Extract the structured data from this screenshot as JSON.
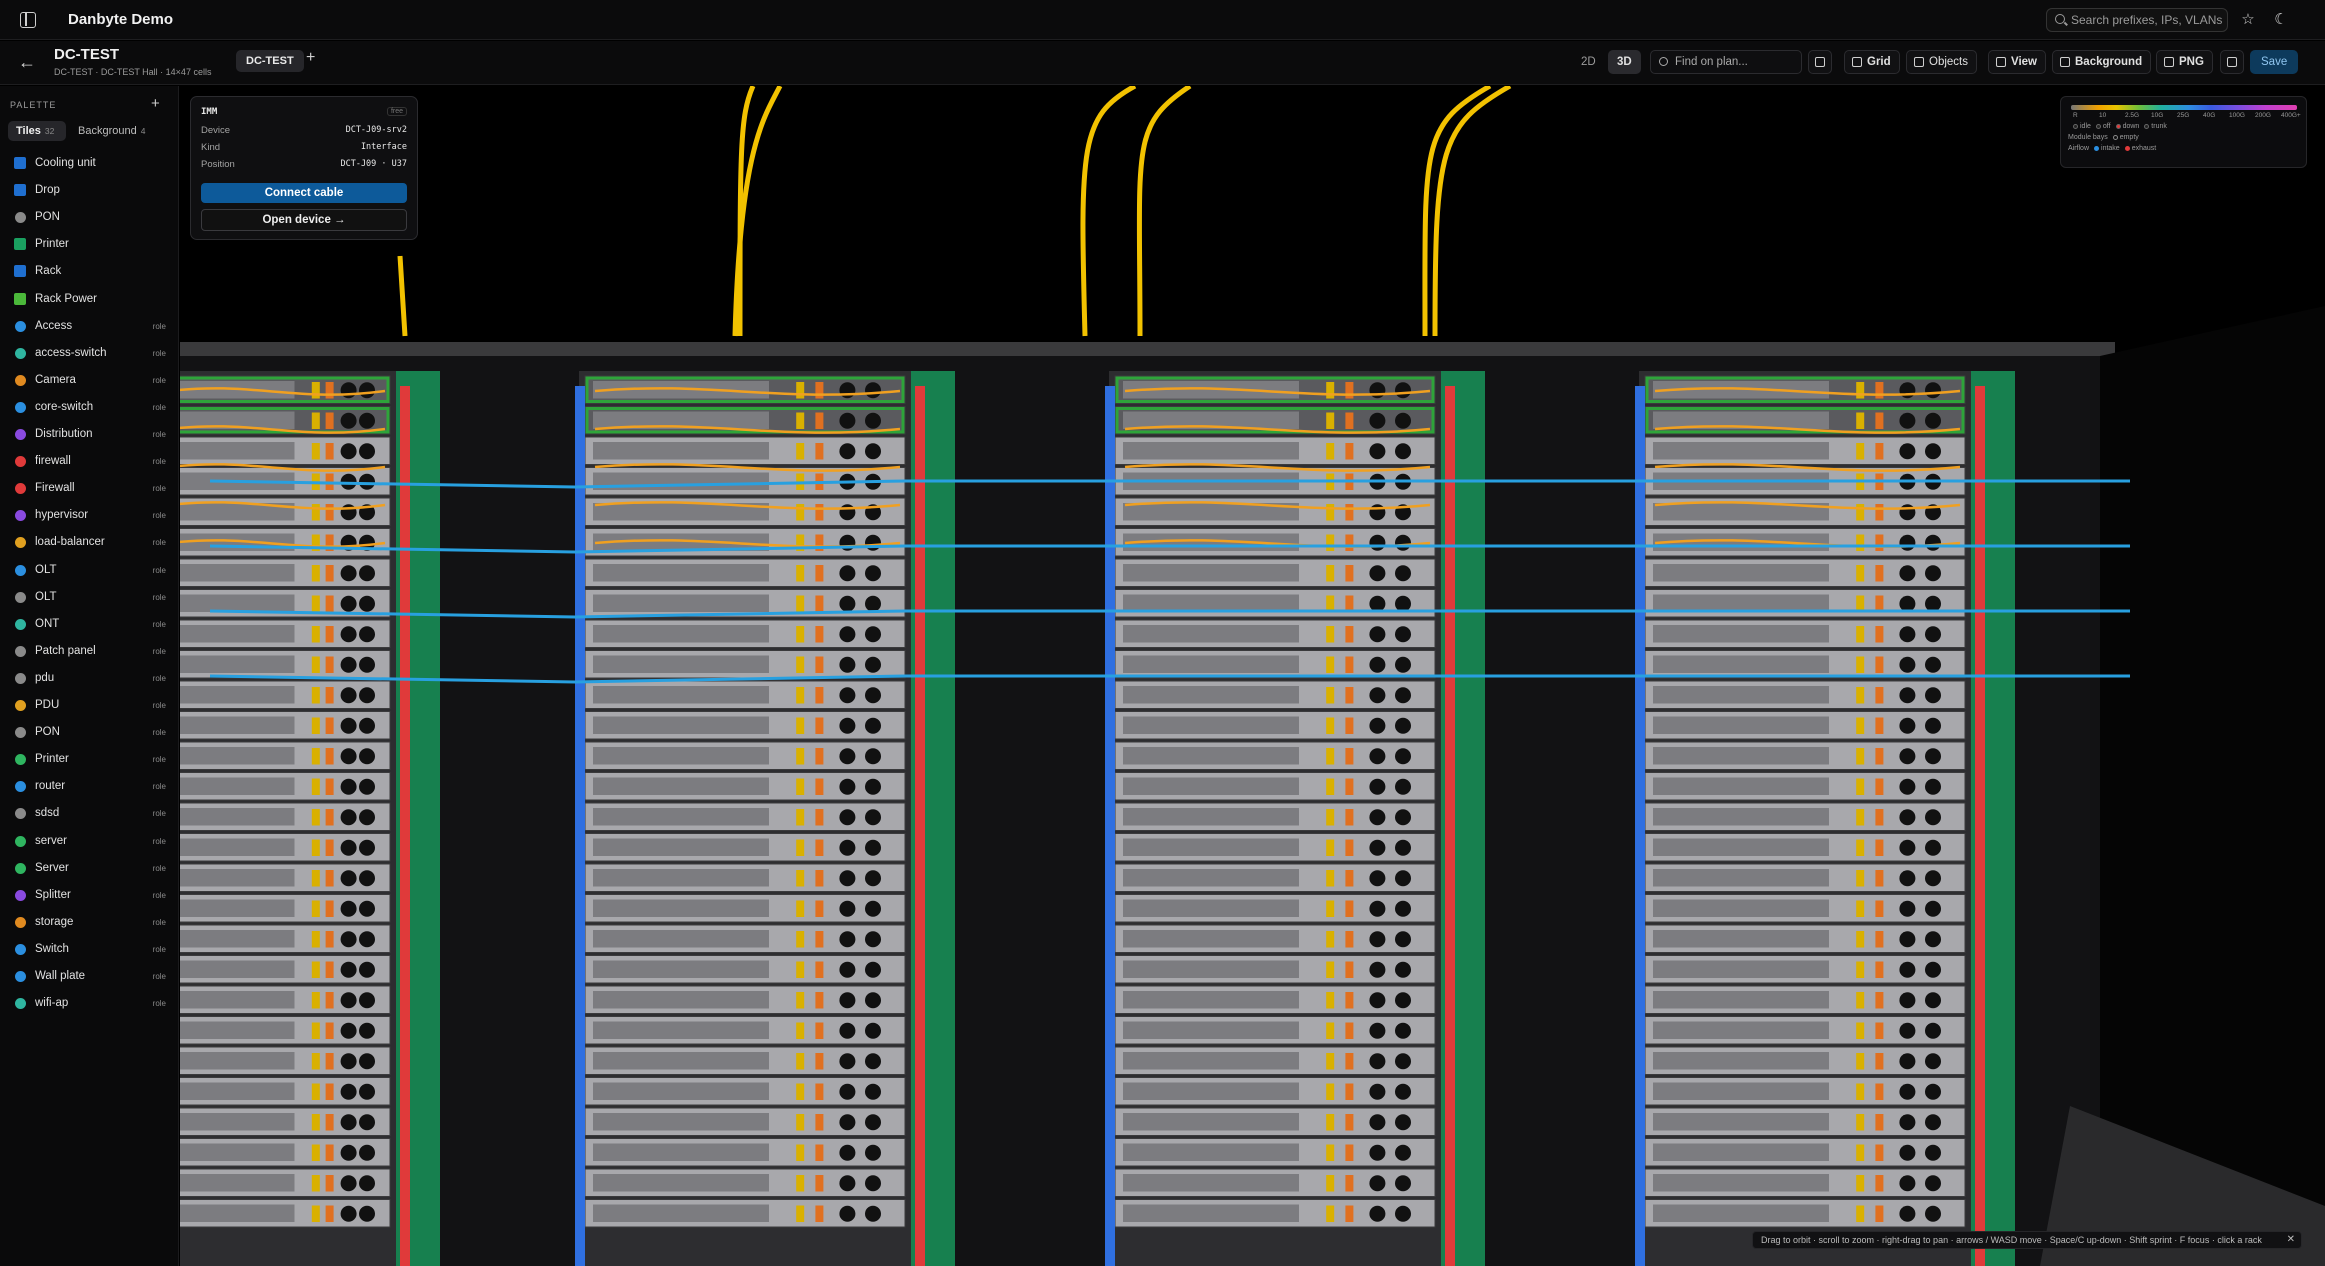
{
  "app": {
    "title": "Danbyte Demo"
  },
  "top": {
    "search_placeholder": "Search prefixes, IPs, VLANs"
  },
  "plan": {
    "name": "DC-TEST",
    "subtitle": "DC-TEST · DC-TEST Hall · 14×47 cells",
    "tab": "DC-TEST"
  },
  "toolbar": {
    "mode_2d": "2D",
    "mode_3d": "3D",
    "find_placeholder": "Find on plan...",
    "grid": "Grid",
    "objects": "Objects",
    "view": "View",
    "background": "Background",
    "png": "PNG",
    "save": "Save"
  },
  "palette": {
    "title": "PALETTE",
    "tab_tiles": "Tiles",
    "tab_tiles_count": "32",
    "tab_background": "Background",
    "tab_background_count": "4",
    "items": [
      {
        "label": "Cooling unit",
        "color": "#1f6fd0",
        "shape": "square",
        "tag": ""
      },
      {
        "label": "Drop",
        "color": "#1f6fd0",
        "shape": "square",
        "tag": ""
      },
      {
        "label": "PON",
        "color": "#8a8a8a",
        "shape": "dot",
        "tag": ""
      },
      {
        "label": "Printer",
        "color": "#1aa060",
        "shape": "square",
        "tag": ""
      },
      {
        "label": "Rack",
        "color": "#1f6fd0",
        "shape": "square",
        "tag": ""
      },
      {
        "label": "Rack Power",
        "color": "#4bb83a",
        "shape": "square",
        "tag": ""
      },
      {
        "label": "Access",
        "color": "#2b8fe0",
        "shape": "dot",
        "tag": "role"
      },
      {
        "label": "access-switch",
        "color": "#2fb5a0",
        "shape": "dot",
        "tag": "role"
      },
      {
        "label": "Camera",
        "color": "#e08a20",
        "shape": "dot",
        "tag": "role"
      },
      {
        "label": "core-switch",
        "color": "#2b8fe0",
        "shape": "dot",
        "tag": "role"
      },
      {
        "label": "Distribution",
        "color": "#8a4ae0",
        "shape": "dot",
        "tag": "role"
      },
      {
        "label": "firewall",
        "color": "#e03a3a",
        "shape": "dot",
        "tag": "role"
      },
      {
        "label": "Firewall",
        "color": "#e03a3a",
        "shape": "dot",
        "tag": "role"
      },
      {
        "label": "hypervisor",
        "color": "#8a4ae0",
        "shape": "dot",
        "tag": "role"
      },
      {
        "label": "load-balancer",
        "color": "#e0a020",
        "shape": "dot",
        "tag": "role"
      },
      {
        "label": "OLT",
        "color": "#2b8fe0",
        "shape": "dot",
        "tag": "role"
      },
      {
        "label": "OLT",
        "color": "#8a8a8a",
        "shape": "dot",
        "tag": "role"
      },
      {
        "label": "ONT",
        "color": "#2fb5a0",
        "shape": "dot",
        "tag": "role"
      },
      {
        "label": "Patch panel",
        "color": "#8a8a8a",
        "shape": "dot",
        "tag": "role"
      },
      {
        "label": "pdu",
        "color": "#8a8a8a",
        "shape": "dot",
        "tag": "role"
      },
      {
        "label": "PDU",
        "color": "#e0a020",
        "shape": "dot",
        "tag": "role"
      },
      {
        "label": "PON",
        "color": "#8a8a8a",
        "shape": "dot",
        "tag": "role"
      },
      {
        "label": "Printer",
        "color": "#2fb560",
        "shape": "dot",
        "tag": "role"
      },
      {
        "label": "router",
        "color": "#2b8fe0",
        "shape": "dot",
        "tag": "role"
      },
      {
        "label": "sdsd",
        "color": "#8a8a8a",
        "shape": "dot",
        "tag": "role"
      },
      {
        "label": "server",
        "color": "#2fb560",
        "shape": "dot",
        "tag": "role"
      },
      {
        "label": "Server",
        "color": "#2fb560",
        "shape": "dot",
        "tag": "role"
      },
      {
        "label": "Splitter",
        "color": "#8a4ae0",
        "shape": "dot",
        "tag": "role"
      },
      {
        "label": "storage",
        "color": "#e08a20",
        "shape": "dot",
        "tag": "role"
      },
      {
        "label": "Switch",
        "color": "#2b8fe0",
        "shape": "dot",
        "tag": "role"
      },
      {
        "label": "Wall plate",
        "color": "#2b8fe0",
        "shape": "dot",
        "tag": "role"
      },
      {
        "label": "wifi-ap",
        "color": "#2fb5a0",
        "shape": "dot",
        "tag": "role"
      }
    ]
  },
  "popup": {
    "title": "IMM",
    "badge": "free",
    "device_label": "Device",
    "device_value": "DCT-J09-srv2",
    "kind_label": "Kind",
    "kind_value": "Interface",
    "position_label": "Position",
    "position_value": "DCT-J09 · U37",
    "connect_label": "Connect cable",
    "open_label": "Open device →"
  },
  "legend": {
    "ticks": [
      "R",
      "10",
      "2.5G",
      "10G",
      "25G",
      "40G",
      "100G",
      "200G",
      "400G+"
    ],
    "status_items": [
      {
        "label": "idle",
        "color": "#222"
      },
      {
        "label": "off",
        "color": "#222"
      },
      {
        "label": "down",
        "color": "#e03a3a"
      },
      {
        "label": "trunk",
        "color": "#222"
      }
    ],
    "module_bays_label": "Module bays",
    "module_bays_value": "empty",
    "airflow_label": "Airflow",
    "intake_label": "intake",
    "intake_color": "#2b8fe0",
    "exhaust_label": "exhaust",
    "exhaust_color": "#e03a3a"
  },
  "hint": {
    "text": "Drag to orbit · scroll to zoom · right-drag to pan · arrows / WASD move · Space/C up-down · Shift sprint · F focus · click a rack"
  },
  "colors": {
    "rack_green": "#17804f",
    "intake": "#2f6fe0",
    "exhaust": "#e03a3a",
    "cable_orange": "#f0a020",
    "cable_blue": "#28a0e0",
    "cable_yellow": "#f2c200",
    "accent": "#0d5a9a"
  }
}
